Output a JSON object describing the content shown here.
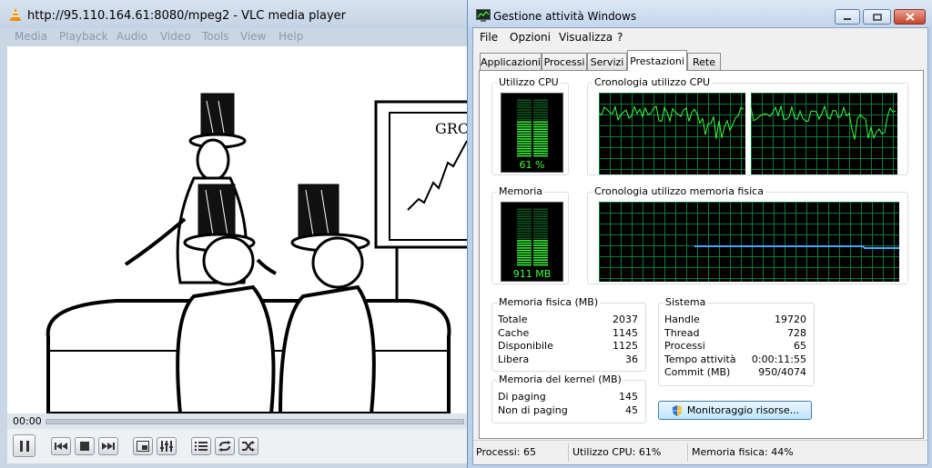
{
  "vlc": {
    "title": "http://95.110.164.61:8080/mpeg2 - VLC media player",
    "menu": [
      "Media",
      "Playback",
      "Audio",
      "Video",
      "Tools",
      "View",
      "Help"
    ],
    "time": "00:00",
    "video_text": "GROW"
  },
  "taskmanager": {
    "title": "Gestione attività Windows",
    "menu": [
      "File",
      "Opzioni",
      "Visualizza",
      "?"
    ],
    "tabs": [
      "Applicazioni",
      "Processi",
      "Servizi",
      "Prestazioni",
      "Rete"
    ],
    "active_tab": "Prestazioni",
    "cpu": {
      "label": "Utilizzo CPU",
      "value": "61 %",
      "level": 0.61
    },
    "cpu_history": {
      "label": "Cronologia utilizzo CPU"
    },
    "memory": {
      "label": "Memoria",
      "value": "911 MB",
      "level": 0.44
    },
    "memory_history": {
      "label": "Cronologia utilizzo memoria fisica"
    },
    "physical_memory": {
      "label": "Memoria fisica (MB)",
      "rows": [
        {
          "name": "Totale",
          "value": "2037"
        },
        {
          "name": "Cache",
          "value": "1145"
        },
        {
          "name": "Disponibile",
          "value": "1125"
        },
        {
          "name": "Libera",
          "value": "36"
        }
      ]
    },
    "kernel_memory": {
      "label": "Memoria del kernel (MB)",
      "rows": [
        {
          "name": "Di paging",
          "value": "145"
        },
        {
          "name": "Non di paging",
          "value": "45"
        }
      ]
    },
    "system": {
      "label": "Sistema",
      "rows": [
        {
          "name": "Handle",
          "value": "19720"
        },
        {
          "name": "Thread",
          "value": "728"
        },
        {
          "name": "Processi",
          "value": "65"
        },
        {
          "name": "Tempo attività",
          "value": "0:00:11:55"
        },
        {
          "name": "Commit (MB)",
          "value": "950/4074"
        }
      ]
    },
    "resource_button": "Monitoraggio risorse...",
    "status": {
      "processes": "Processi: 65",
      "cpu": "Utilizzo CPU: 61%",
      "memory": "Memoria fisica: 44%"
    },
    "colors": {
      "meter_green": "#3cff3c",
      "grid": "#0a7a3a",
      "memory_line": "#4aa3ff"
    }
  }
}
